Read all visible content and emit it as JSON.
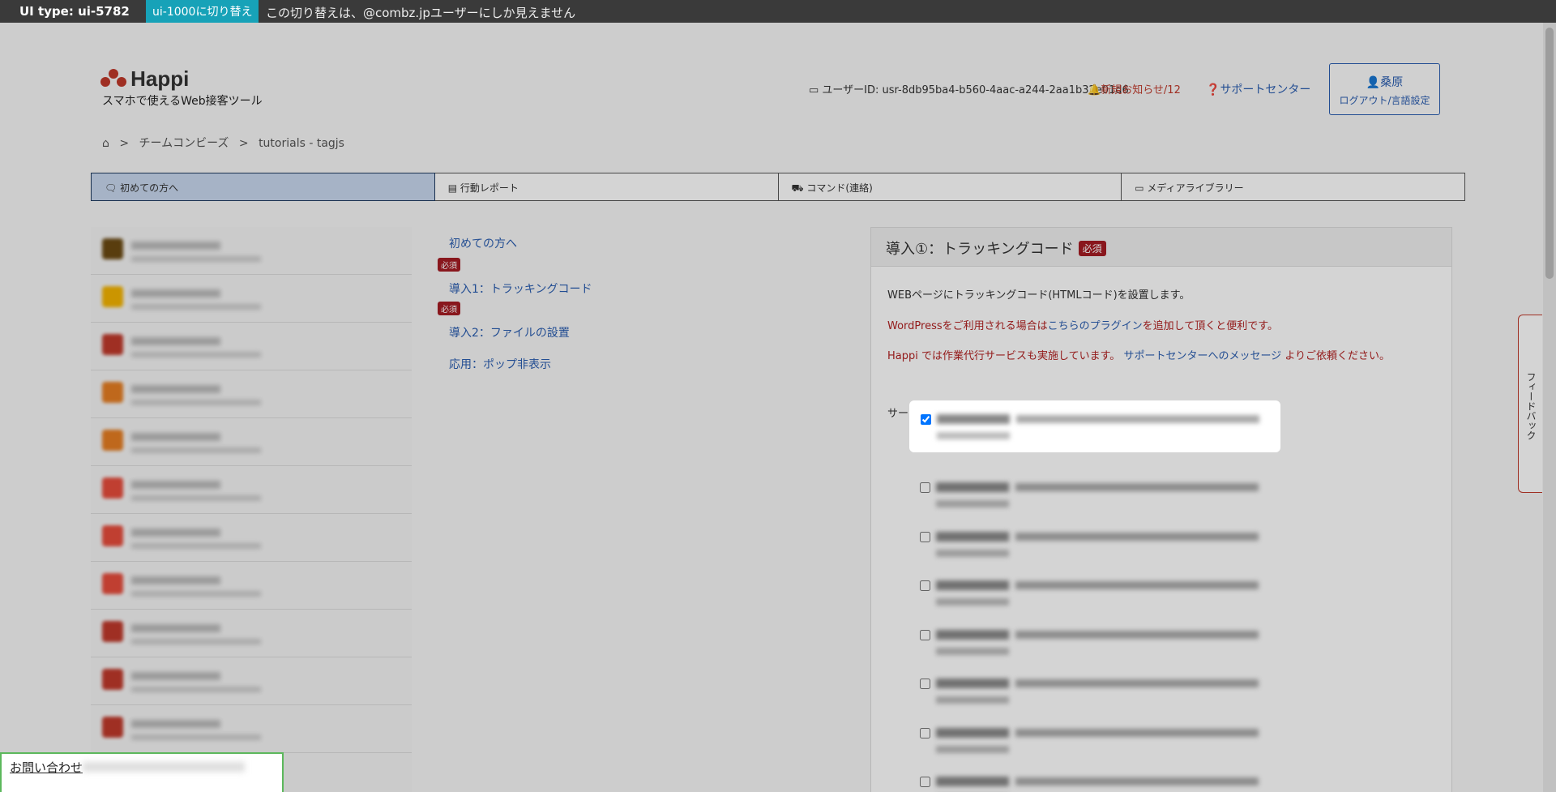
{
  "topbar": {
    "ui_type": "UI type: ui-5782",
    "switch_label": "ui-1000に切り替え",
    "note": "この切り替えは、@combz.jpユーザーにしか見えません"
  },
  "header": {
    "logo": "Happi",
    "tagline": "スマホで使えるWeb接客ツール",
    "user_id": "ユーザーID: usr-8db95ba4-b560-4aac-a244-2aa1b32e01d6",
    "notice": "新規お知らせ/12",
    "support": "サポートセンター",
    "user_name": "桑原",
    "user_link": "ログアウト/言語設定"
  },
  "breadcrumb": {
    "team": "チームコンビーズ",
    "project": "tutorials - tagjs"
  },
  "tabs": [
    {
      "label": "初めての方へ"
    },
    {
      "label": "行動レポート"
    },
    {
      "label": "コマンド(連絡)"
    },
    {
      "label": "メディアライブラリー"
    }
  ],
  "steps": {
    "intro": "初めての方へ",
    "req1": "必須",
    "step1": "導入1：トラッキングコード",
    "req2": "必須",
    "step2": "導入2：ファイルの設置",
    "step3": "応用：ポップ非表示"
  },
  "panel": {
    "title": "導入①：トラッキングコード",
    "required": "必須",
    "p1": "WEBページにトラッキングコード(HTMLコード)を設置します。",
    "p2_a": "WordPressをご利用される場合は",
    "p2_link": "こちらのプラグイン",
    "p2_b": "を追加して頂くと便利です。",
    "p3_a": "Happi では作業代行サービスも実施しています。 ",
    "p3_link": "サポートセンターへのメッセージ",
    "p3_b": " よりご依頼ください。",
    "p4": "サービスを選んでください。"
  },
  "feedback": "フィードバック",
  "contact": "お問い合わせ"
}
